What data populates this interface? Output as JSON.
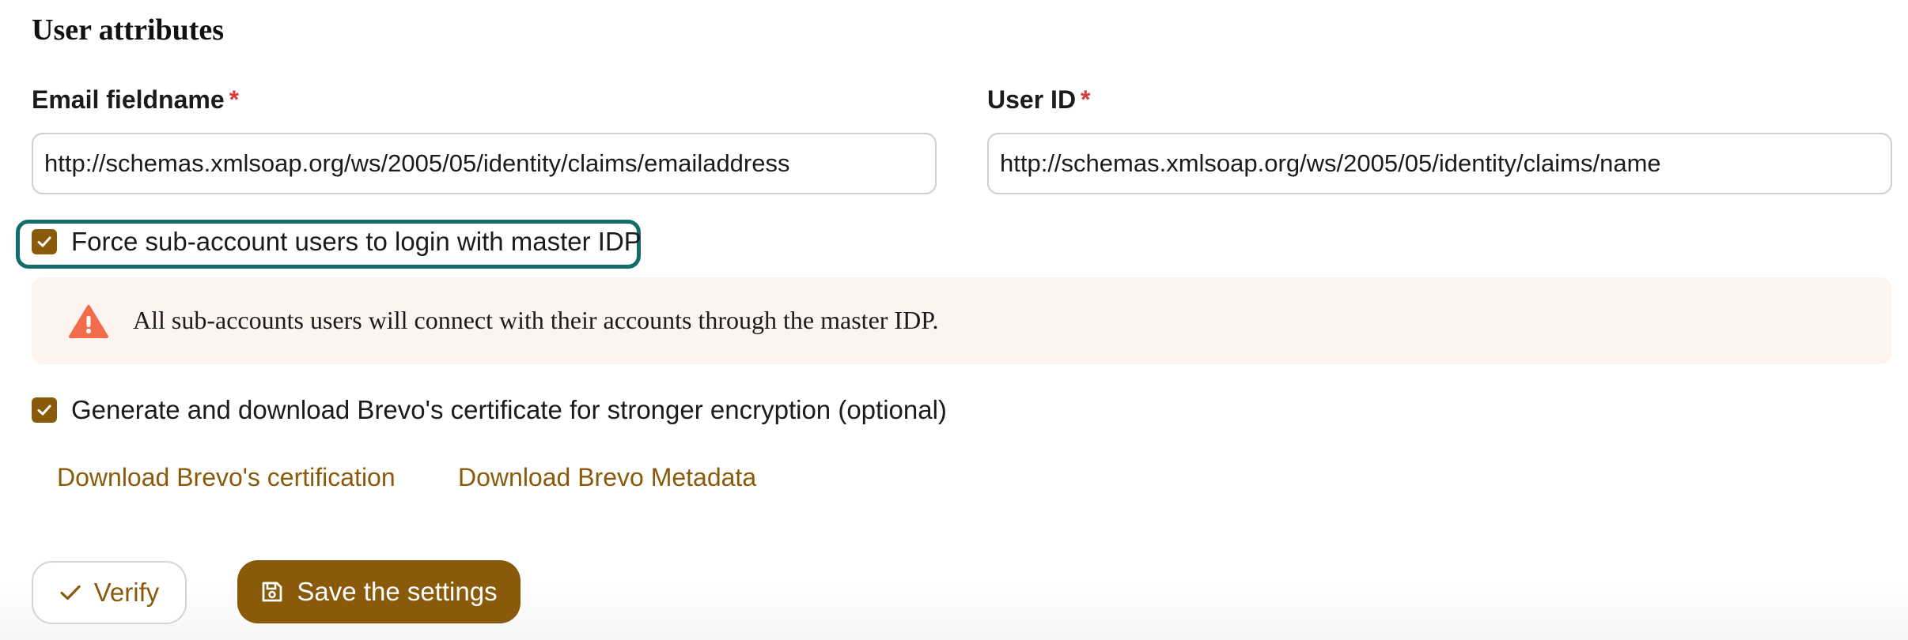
{
  "section": {
    "title": "User attributes"
  },
  "email_field": {
    "label": "Email fieldname",
    "required_marker": "*",
    "value": "http://schemas.xmlsoap.org/ws/2005/05/identity/claims/emailaddress"
  },
  "userid_field": {
    "label": "User ID",
    "required_marker": "*",
    "value": "http://schemas.xmlsoap.org/ws/2005/05/identity/claims/name"
  },
  "force_login": {
    "label": "Force sub-account users to login with master IDP",
    "checked": true
  },
  "alert": {
    "text": "All sub-accounts users will connect with their accounts through the master IDP.",
    "icon": "warning-icon",
    "color": "#f26b4a"
  },
  "certificate": {
    "label": "Generate and download Brevo's certificate for stronger encryption (optional)",
    "checked": true
  },
  "links": {
    "download_cert": "Download Brevo's certification",
    "download_metadata": "Download Brevo Metadata"
  },
  "buttons": {
    "verify": "Verify",
    "save": "Save the settings"
  },
  "colors": {
    "brand": "#8a5a0b",
    "focus_ring": "#136b6b",
    "alert_bg": "#fdf3ef",
    "required": "#d93b3b"
  }
}
